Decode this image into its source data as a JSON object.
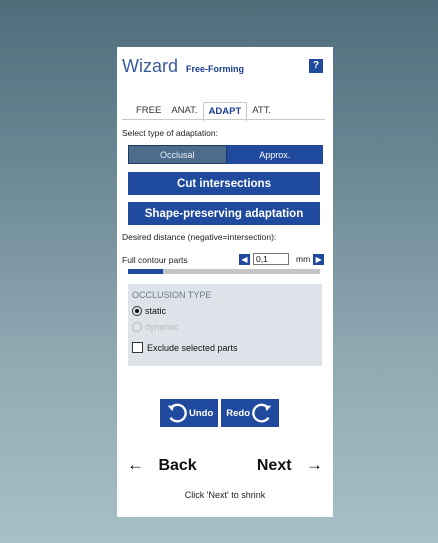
{
  "header": {
    "title": "Wizard",
    "subtitle": "Free-Forming",
    "help": "?"
  },
  "tabs": [
    {
      "label": "FREE",
      "active": false
    },
    {
      "label": "ANAT.",
      "active": false
    },
    {
      "label": "ADAPT",
      "active": true
    },
    {
      "label": "ATT.",
      "active": false
    }
  ],
  "adaptation": {
    "prompt": "Select type of adaptation:",
    "options": [
      "Occlusal",
      "Approx."
    ],
    "selected": "Occlusal"
  },
  "buttons": {
    "cut": "Cut intersections",
    "shape": "Shape-preserving adaptation"
  },
  "distance": {
    "label": "Desired distance (negative=intersection):",
    "contour_label": "Full contour parts",
    "value": "0,1",
    "unit": "mm",
    "progress_fraction": 0.18
  },
  "occlusion": {
    "title": "OCCLUSION TYPE",
    "static_label": "static",
    "dynamic_label": "dynamic",
    "exclude_label": "Exclude selected parts"
  },
  "history": {
    "undo": "Undo",
    "redo": "Redo"
  },
  "nav": {
    "back": "Back",
    "next": "Next",
    "back_arrow": "←",
    "next_arrow": "→"
  },
  "footer": "Click 'Next' to shrink",
  "colors": {
    "accent": "#1f4a9e",
    "panel": "#ffffff",
    "occlusion_bg": "#dde3e8"
  }
}
